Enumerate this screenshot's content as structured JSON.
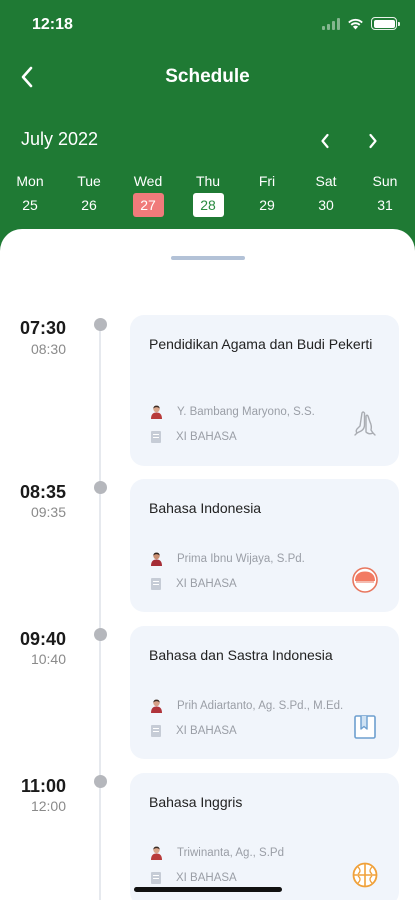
{
  "status_bar": {
    "time": "12:18"
  },
  "header": {
    "title": "Schedule"
  },
  "calendar": {
    "month_label": "July 2022",
    "days": [
      {
        "name": "Mon",
        "num": "25"
      },
      {
        "name": "Tue",
        "num": "26"
      },
      {
        "name": "Wed",
        "num": "27"
      },
      {
        "name": "Thu",
        "num": "28"
      },
      {
        "name": "Fri",
        "num": "29"
      },
      {
        "name": "Sat",
        "num": "30"
      },
      {
        "name": "Sun",
        "num": "31"
      }
    ],
    "today_day": "27",
    "selected_day": "28"
  },
  "schedule": [
    {
      "start": "07:30",
      "end": "08:30",
      "subject": "Pendidikan Agama dan Budi Pekerti",
      "teacher": "Y. Bambang Maryono, S.S.",
      "class": "XI BAHASA",
      "icon": "praying-hands-icon"
    },
    {
      "start": "08:35",
      "end": "09:35",
      "subject": "Bahasa Indonesia",
      "teacher": "Prima Ibnu Wijaya, S.Pd.",
      "class": "XI BAHASA",
      "icon": "indonesia-flag-icon"
    },
    {
      "start": "09:40",
      "end": "10:40",
      "subject": "Bahasa dan Sastra Indonesia",
      "teacher": "Prih Adiartanto, Ag. S.Pd., M.Ed.",
      "class": "XI BAHASA",
      "icon": "book-icon"
    },
    {
      "start": "11:00",
      "end": "12:00",
      "subject": "Bahasa Inggris",
      "teacher": "Triwinanta, Ag., S.Pd",
      "class": "XI BAHASA",
      "icon": "globe-icon"
    }
  ],
  "colors": {
    "header": "#1f7a34",
    "today": "#f07b7b",
    "card": "#f1f5fb"
  }
}
